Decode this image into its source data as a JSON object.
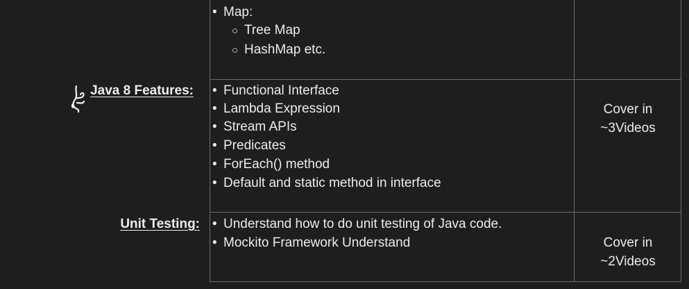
{
  "map_section": {
    "items": [
      {
        "text": "Map:",
        "level": 1
      },
      {
        "text": "Tree Map",
        "level": 2
      },
      {
        "text": "HashMap etc.",
        "level": 2
      }
    ]
  },
  "java8_section": {
    "title": "Java 8 Features:",
    "items": [
      "Functional Interface",
      "Lambda Expression",
      "Stream APIs",
      "Predicates",
      "ForEach() method",
      "Default and static method in interface"
    ],
    "cover_line1": "Cover in",
    "cover_line2": "~3Videos"
  },
  "unit_testing_section": {
    "title": "Unit Testing:",
    "items": [
      "Understand how to do unit testing of Java code.",
      "Mockito Framework Understand"
    ],
    "cover_line1": "Cover in",
    "cover_line2": "~2Videos"
  },
  "bullet_char": "•",
  "sub_bullet_char": "○"
}
